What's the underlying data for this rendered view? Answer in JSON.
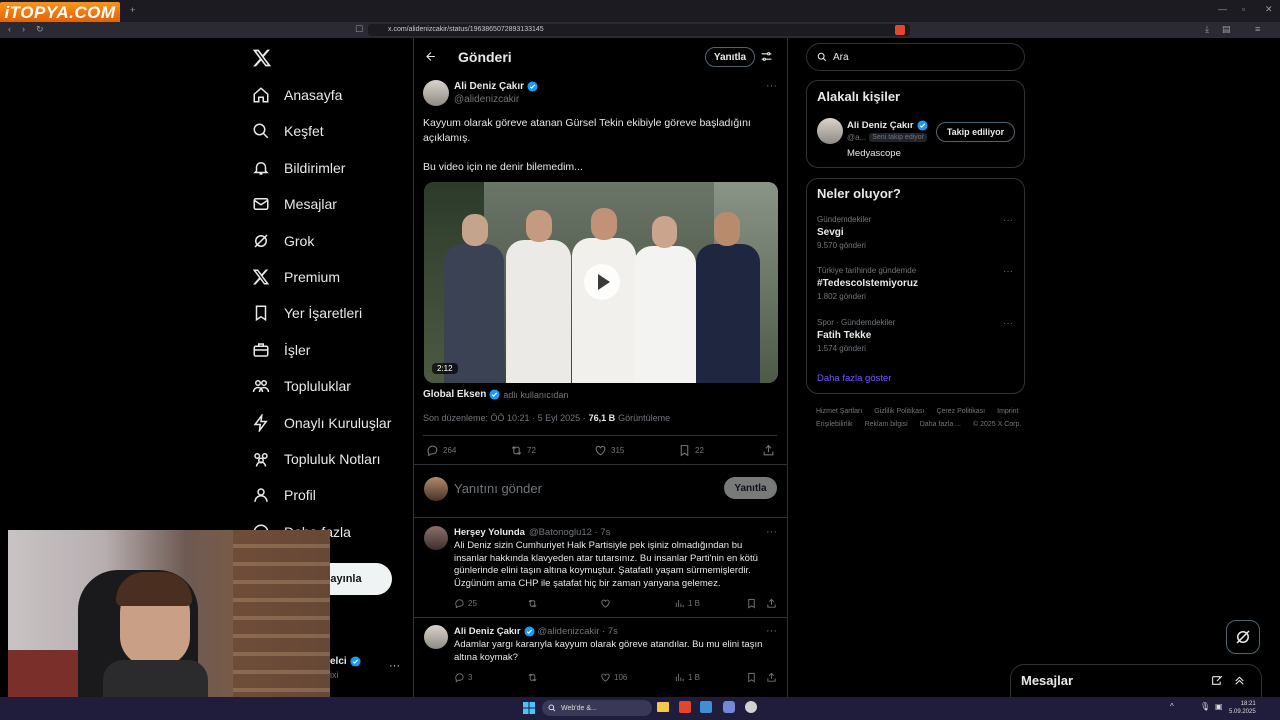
{
  "browser": {
    "url": "x.com/alidenizcakir/status/1963865072893133145",
    "new_tab": "+",
    "watermark": "iTOPYA.COM"
  },
  "nav": {
    "items": [
      {
        "label": "Anasayfa",
        "icon": "home-icon"
      },
      {
        "label": "Keşfet",
        "icon": "search-icon"
      },
      {
        "label": "Bildirimler",
        "icon": "bell-icon"
      },
      {
        "label": "Mesajlar",
        "icon": "mail-icon"
      },
      {
        "label": "Grok",
        "icon": "grok-icon"
      },
      {
        "label": "Premium",
        "icon": "x-logo-icon"
      },
      {
        "label": "Yer İşaretleri",
        "icon": "bookmark-icon"
      },
      {
        "label": "İşler",
        "icon": "briefcase-icon"
      },
      {
        "label": "Topluluklar",
        "icon": "people-icon"
      },
      {
        "label": "Onaylı Kuruluşlar",
        "icon": "lightning-icon"
      },
      {
        "label": "Topluluk Notları",
        "icon": "notes-icon"
      },
      {
        "label": "Profil",
        "icon": "person-icon"
      },
      {
        "label": "Daha fazla",
        "icon": "more-icon"
      }
    ],
    "post_button": "ayınla",
    "account_name_fragment": "elci",
    "account_handle_fragment": "ixi"
  },
  "header": {
    "title": "Gönderi",
    "reply_button": "Yanıtla"
  },
  "tweet": {
    "author": "Ali Deniz Çakır",
    "handle": "@alidenizcakir",
    "text_line1": "Kayyum olarak göreve atanan Gürsel Tekin ekibiyle göreve başladığını",
    "text_line2": "açıklamış.",
    "text_line3": "Bu video için ne denir bilemedim...",
    "video_duration": "2:12",
    "source_name": "Global Eksen",
    "source_suffix": "adlı kullanıcıdan",
    "edited": "Son düzenleme: ÖÖ 10:21 · 5 Eyl 2025 ·",
    "views": "76,1 B",
    "views_label": "Görüntüleme",
    "stats": {
      "replies": "264",
      "retweets": "72",
      "likes": "315",
      "bookmarks": "22"
    }
  },
  "composer": {
    "placeholder": "Yanıtını gönder",
    "button": "Yanıtla"
  },
  "replies": [
    {
      "author": "Herşey Yolunda",
      "handle": "@Batonoglu12 · 7s",
      "lines": [
        "Ali Deniz sizin Cumhuriyet Halk Partisiyle pek işiniz olmadığından bu",
        "insanlar hakkında klavyeden atar tutarsınız. Bu insanlar Parti'nin en kötü",
        "günlerinde elini taşın altına koymuştur. Şatafatlı yaşam sürmemişlerdir.",
        "Üzgünüm ama CHP ile şatafat hiç bir zaman yanyana gelemez."
      ],
      "replies": "25",
      "retweets": "",
      "likes": "",
      "views": "1 B"
    },
    {
      "author": "Ali Deniz Çakır",
      "handle": "@alidenizcakir · 7s",
      "lines": [
        "Adamlar yargı kararıyla kayyum olarak göreve atandılar. Bu mu elini taşın",
        "altına koymak?"
      ],
      "replies": "3",
      "retweets": "",
      "likes": "106",
      "views": "1 B"
    }
  ],
  "search": {
    "placeholder": "Ara"
  },
  "related": {
    "title": "Alakalı kişiler",
    "name": "Ali Deniz Çakır",
    "handle": "@a...",
    "follows_you": "Seni takip ediyor",
    "bio": "Medyascope",
    "follow_button": "Takip ediliyor"
  },
  "trends": {
    "title": "Neler oluyor?",
    "items": [
      {
        "category": "Gündemdekiler",
        "name": "Sevgi",
        "count": "9.570 gönderi"
      },
      {
        "category": "Türkiye tarihinde gündemde",
        "name": "#TedescoIstemiyoruz",
        "count": "1.802 gönderi"
      },
      {
        "category": "Spor · Gündemdekiler",
        "name": "Fatih Tekke",
        "count": "1.574 gönderi"
      }
    ],
    "show_more": "Daha fazla göster"
  },
  "footer": {
    "links": [
      "Hizmet Şartları",
      "Gizlilik Politikası",
      "Çerez Politikası",
      "Imprint",
      "Erişilebilirlik",
      "Reklam bilgisi",
      "Daha fazla ...",
      "© 2025 X Corp."
    ]
  },
  "messages_drawer": {
    "title": "Mesajlar"
  },
  "taskbar": {
    "search_placeholder": "Web'de &...",
    "time": "18:21",
    "date": "5.09.2025"
  },
  "colors": {
    "accent": "#1d9bf0",
    "link": "#7856ff",
    "taskbar": "#1f1d3b"
  }
}
